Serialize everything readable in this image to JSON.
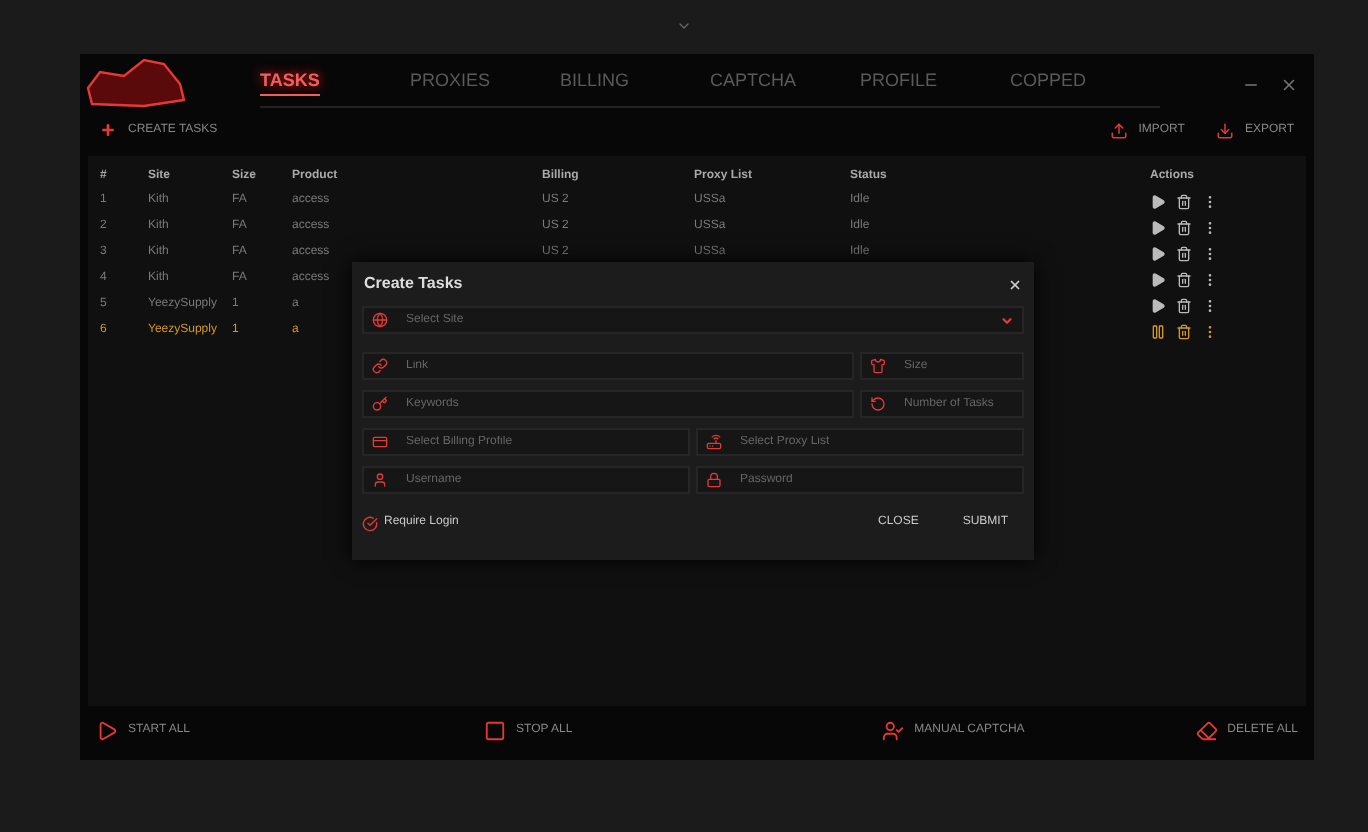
{
  "tabs": [
    {
      "label": "TASKS",
      "selected": true
    },
    {
      "label": "PROXIES",
      "selected": false
    },
    {
      "label": "BILLING",
      "selected": false
    },
    {
      "label": "CAPTCHA",
      "selected": false
    },
    {
      "label": "PROFILE",
      "selected": false
    },
    {
      "label": "COPPED",
      "selected": false
    }
  ],
  "toolbar": {
    "create": "CREATE TASKS",
    "import": "IMPORT",
    "export": "EXPORT"
  },
  "table": {
    "columns": [
      "#",
      "Site",
      "Size",
      "Product",
      "Billing",
      "Proxy List",
      "Status",
      "Actions"
    ],
    "rows": [
      {
        "cells": [
          "1",
          "Kith",
          "FA",
          "access",
          "US 2",
          "USSa",
          "Idle"
        ],
        "running": false
      },
      {
        "cells": [
          "2",
          "Kith",
          "FA",
          "access",
          "US 2",
          "USSa",
          "Idle"
        ],
        "running": false
      },
      {
        "cells": [
          "3",
          "Kith",
          "FA",
          "access",
          "US 2",
          "USSa",
          "Idle"
        ],
        "running": false
      },
      {
        "cells": [
          "4",
          "Kith",
          "FA",
          "access"
        ],
        "running": false
      },
      {
        "cells": [
          "5",
          "YeezySupply",
          "1",
          "a"
        ],
        "running": false
      },
      {
        "cells": [
          "6",
          "YeezySupply",
          "1",
          "a"
        ],
        "running": true
      }
    ]
  },
  "dialog": {
    "title": "Create Tasks",
    "field_rows": [
      [
        {
          "kind": "dropdown",
          "placeholder": "Select Site"
        }
      ],
      [
        {
          "kind": "text",
          "placeholder": "Link"
        },
        {
          "kind": "text",
          "placeholder": "Size"
        }
      ],
      [
        {
          "kind": "text",
          "placeholder": "Keywords"
        },
        {
          "kind": "text",
          "placeholder": "Number of Tasks"
        }
      ],
      [
        {
          "kind": "text",
          "placeholder": "Select Billing Profile"
        },
        {
          "kind": "text",
          "placeholder": "Select Proxy List"
        }
      ],
      [
        {
          "kind": "text",
          "placeholder": "Username"
        },
        {
          "kind": "text",
          "placeholder": "Password"
        }
      ]
    ],
    "require_login": {
      "label": "Require Login",
      "checked": true
    },
    "buttons": [
      "CLOSE",
      "SUBMIT"
    ]
  },
  "bottom_bar": [
    "START ALL",
    "STOP ALL",
    "MANUAL CAPTCHA",
    "DELETE ALL"
  ]
}
